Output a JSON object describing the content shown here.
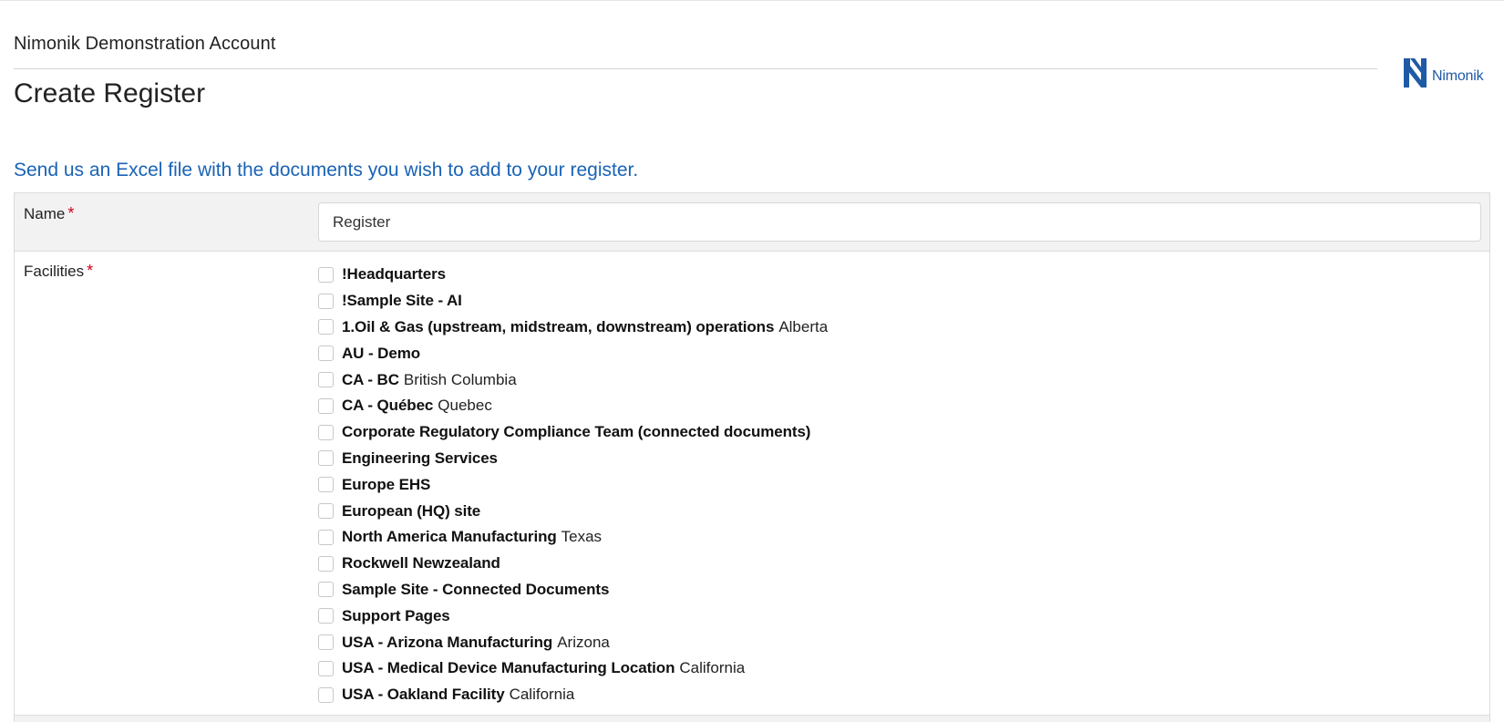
{
  "header": {
    "account_name": "Nimonik Demonstration Account",
    "page_title": "Create Register",
    "logo_text": "Nimonik"
  },
  "instructions": "Send us an Excel file with the documents you wish to add to your register.",
  "form": {
    "name": {
      "label": "Name",
      "required_marker": "*",
      "value": "Register"
    },
    "facilities": {
      "label": "Facilities",
      "required_marker": "*",
      "items": [
        {
          "name": "!Headquarters",
          "location": ""
        },
        {
          "name": "!Sample Site - AI",
          "location": ""
        },
        {
          "name": "1.Oil & Gas (upstream, midstream, downstream) operations",
          "location": "Alberta"
        },
        {
          "name": "AU - Demo",
          "location": ""
        },
        {
          "name": "CA - BC",
          "location": "British Columbia"
        },
        {
          "name": "CA - Québec",
          "location": "Quebec"
        },
        {
          "name": "Corporate Regulatory Compliance Team (connected documents)",
          "location": ""
        },
        {
          "name": "Engineering Services",
          "location": ""
        },
        {
          "name": "Europe EHS",
          "location": ""
        },
        {
          "name": "European (HQ) site",
          "location": ""
        },
        {
          "name": "North America Manufacturing",
          "location": "Texas"
        },
        {
          "name": "Rockwell Newzealand",
          "location": ""
        },
        {
          "name": "Sample Site - Connected Documents",
          "location": ""
        },
        {
          "name": "Support Pages",
          "location": ""
        },
        {
          "name": "USA - Arizona Manufacturing",
          "location": "Arizona"
        },
        {
          "name": "USA - Medical Device Manufacturing Location",
          "location": "California"
        },
        {
          "name": "USA - Oakland Facility",
          "location": "California"
        }
      ]
    }
  },
  "colors": {
    "brand_blue": "#1f5aa6",
    "link_blue": "#1a63b5",
    "required_red": "#d0021b",
    "row_background": "#f2f2f2"
  }
}
